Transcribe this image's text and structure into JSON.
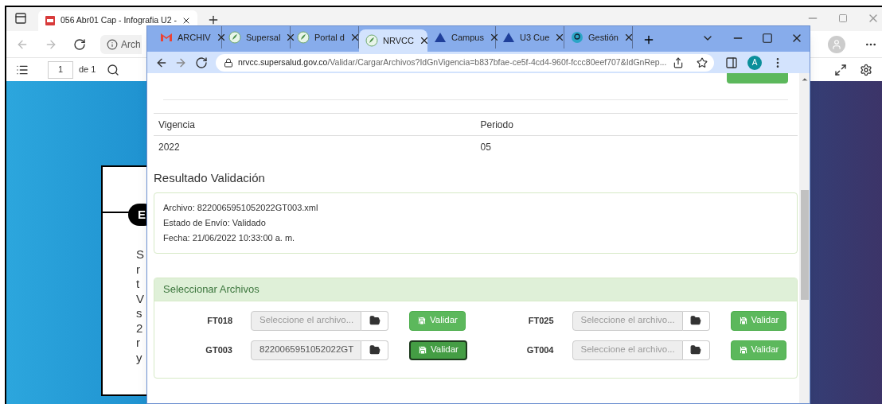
{
  "back_window": {
    "tab": {
      "title": "056 Abr01 Cap - Infografia U2 -"
    },
    "address": "Arch",
    "pdf_toolbar": {
      "page": "1",
      "page_count": "de 1"
    },
    "sheet": {
      "badge": "E",
      "letters": [
        "S",
        "r",
        "t",
        "V",
        "s",
        "2",
        "r",
        "y"
      ]
    }
  },
  "browser": {
    "tabs": [
      {
        "title": "ARCHIV",
        "kind": "mail",
        "selected": false
      },
      {
        "title": "Supersal",
        "kind": "leaf",
        "selected": false
      },
      {
        "title": "Portal d",
        "kind": "leaf",
        "selected": false
      },
      {
        "title": "NRVCC",
        "kind": "leaf",
        "selected": true
      },
      {
        "title": "Campus",
        "kind": "triangle",
        "selected": false
      },
      {
        "title": "U3 Cue",
        "kind": "triangle",
        "selected": false
      },
      {
        "title": "Gestión",
        "kind": "ring",
        "selected": false
      }
    ],
    "url_host": "nrvcc.supersalud.gov.co",
    "url_path": "/Validar/CargarArchivos?IdGnVigencia=b837bfae-ce5f-4cd4-960f-fccc80eef707&IdGnRep...",
    "avatar": "A"
  },
  "page": {
    "table": {
      "columns": [
        "Vigencia",
        "Periodo"
      ],
      "rows": [
        [
          "2022",
          "05"
        ]
      ]
    },
    "result": {
      "title": "Resultado Validación",
      "lines": [
        "Archivo: 8220065951052022GT003.xml",
        "Estado de Envío: Validado",
        "Fecha: 21/06/2022 10:33:00 a. m."
      ]
    },
    "files": {
      "title": "Seleccionar Archivos",
      "items": [
        {
          "label": "FT018",
          "placeholder": "Seleccione el archivo...",
          "button": "Validar",
          "focused": false
        },
        {
          "label": "FT025",
          "placeholder": "Seleccione el archivo...",
          "button": "Validar",
          "focused": false
        },
        {
          "label": "GT003",
          "value": "8220065951052022GT",
          "button": "Validar",
          "focused": true
        },
        {
          "label": "GT004",
          "placeholder": "Seleccione el archivo...",
          "button": "Validar",
          "focused": false
        }
      ]
    }
  }
}
